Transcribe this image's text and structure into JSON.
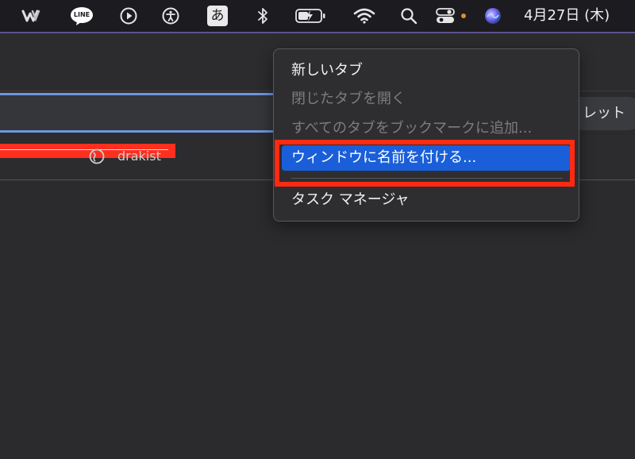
{
  "menubar": {
    "line_icon_label": "LINE",
    "ime_label": "あ",
    "clock": "4月27日 (木)",
    "colors": {
      "background": "#1c1b1f",
      "status_dot": "#e8892c"
    },
    "icons": [
      "webex-icon",
      "line-icon",
      "play-icon",
      "accessibility-icon",
      "input-method-icon",
      "bluetooth-icon",
      "battery-charging-icon",
      "wifi-icon",
      "search-icon",
      "control-center-icon",
      "siri-icon"
    ]
  },
  "toolbar": {
    "right_pill_label": "レット"
  },
  "bookmarks": {
    "item2_label": "drakist"
  },
  "context_menu": {
    "items": [
      {
        "label": "新しいタブ",
        "enabled": true
      },
      {
        "label": "閉じたタブを開く",
        "enabled": false
      },
      {
        "label": "すべてのタブをブックマークに追加...",
        "enabled": false
      },
      {
        "label": "ウィンドウに名前を付ける...",
        "enabled": true,
        "selected": true
      },
      {
        "label": "タスク マネージャ",
        "enabled": true
      }
    ],
    "colors": {
      "highlight": "#1a5fd9",
      "annotation_outline": "#ff2a12"
    }
  }
}
